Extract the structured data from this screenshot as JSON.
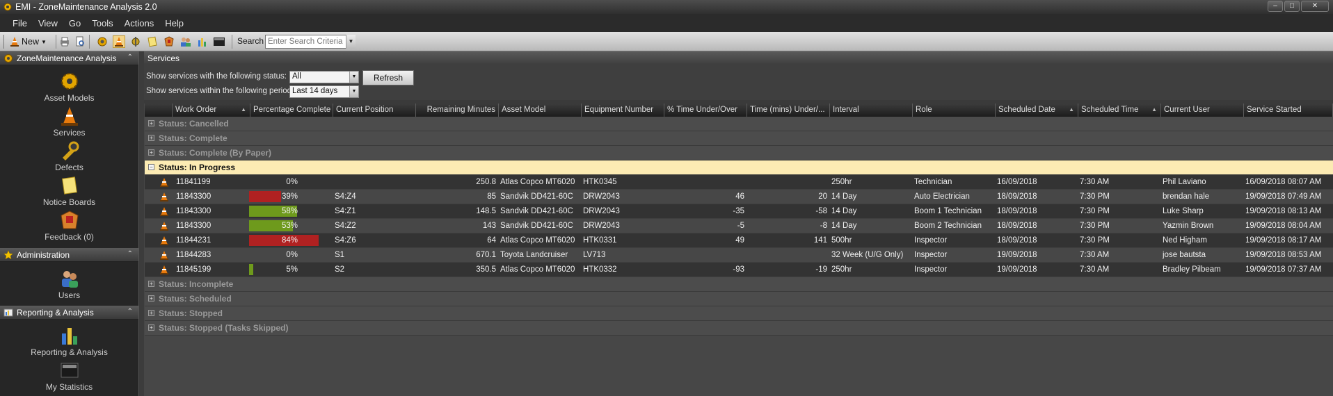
{
  "window": {
    "title": "EMI - ZoneMaintenance Analysis 2.0",
    "minimize": "–",
    "maximize": "□",
    "close": "✕"
  },
  "menu": [
    "File",
    "View",
    "Go",
    "Tools",
    "Actions",
    "Help"
  ],
  "toolbar": {
    "new_label": "New",
    "search_label": "Search",
    "search_placeholder": "Enter Search Criteria",
    "icons": [
      "print-icon",
      "preview-icon",
      "gear-icon",
      "cone-icon",
      "settings-icon",
      "note-icon",
      "feedback-icon",
      "users-icon",
      "chart-icon",
      "statistics-icon"
    ]
  },
  "sidebar": {
    "sections": [
      {
        "title": "ZoneMaintenance Analysis",
        "items": [
          "Asset Models",
          "Services",
          "Defects",
          "Notice Boards",
          "Feedback (0)"
        ]
      },
      {
        "title": "Administration",
        "items": [
          "Users"
        ]
      },
      {
        "title": "Reporting & Analysis",
        "items": [
          "Reporting & Analysis",
          "My Statistics"
        ]
      }
    ]
  },
  "services": {
    "header": "Services",
    "status_filter_label": "Show services with the following status:",
    "status_filter_value": "All",
    "period_filter_label": "Show services within the following period:",
    "period_filter_value": "Last 14 days",
    "refresh_label": "Refresh"
  },
  "grid": {
    "columns": [
      "Work Order",
      "Percentage Complete",
      "Current Position",
      "Remaining Minutes",
      "Asset Model",
      "Equipment Number",
      "% Time Under/Over",
      "Time (mins) Under/...",
      "Interval",
      "Role",
      "Scheduled Date",
      "Scheduled Time",
      "Current User",
      "Service Started"
    ],
    "groups_before": [
      "Status: Cancelled",
      "Status: Complete",
      "Status: Complete (By Paper)"
    ],
    "active_group": "Status: In Progress",
    "groups_after": [
      "Status: Incomplete",
      "Status: Scheduled",
      "Status: Stopped",
      "Status: Stopped (Tasks Skipped)"
    ],
    "rows": [
      {
        "work_order": "11841199",
        "pct": "0%",
        "pct_value": 0,
        "bar_color": "",
        "position": "",
        "remaining": "250.8",
        "asset": "Atlas Copco MT6020",
        "equipment": "HTK0345",
        "pct_time": "",
        "time_mins": "",
        "interval": "250hr",
        "role": "Technician",
        "sched_date": "16/09/2018",
        "sched_time": "7:30 AM",
        "user": "Phil Laviano",
        "started": "16/09/2018 08:07 AM"
      },
      {
        "work_order": "11843300",
        "pct": "39%",
        "pct_value": 39,
        "bar_color": "#b02121",
        "position": "S4:Z4",
        "remaining": "85",
        "asset": "Sandvik DD421-60C",
        "equipment": "DRW2043",
        "pct_time": "46",
        "time_mins": "20",
        "interval": "14 Day",
        "role": "Auto Electrician",
        "sched_date": "18/09/2018",
        "sched_time": "7:30 PM",
        "user": "brendan hale",
        "started": "19/09/2018 07:49 AM"
      },
      {
        "work_order": "11843300",
        "pct": "58%",
        "pct_value": 58,
        "bar_color": "#6e9a1c",
        "position": "S4:Z1",
        "remaining": "148.5",
        "asset": "Sandvik DD421-60C",
        "equipment": "DRW2043",
        "pct_time": "-35",
        "time_mins": "-58",
        "interval": "14 Day",
        "role": "Boom 1 Technician",
        "sched_date": "18/09/2018",
        "sched_time": "7:30 PM",
        "user": "Luke Sharp",
        "started": "19/09/2018 08:13 AM"
      },
      {
        "work_order": "11843300",
        "pct": "53%",
        "pct_value": 53,
        "bar_color": "#6e9a1c",
        "position": "S4:Z2",
        "remaining": "143",
        "asset": "Sandvik DD421-60C",
        "equipment": "DRW2043",
        "pct_time": "-5",
        "time_mins": "-8",
        "interval": "14 Day",
        "role": "Boom 2 Technician",
        "sched_date": "18/09/2018",
        "sched_time": "7:30 PM",
        "user": "Yazmin Brown",
        "started": "19/09/2018 08:04 AM"
      },
      {
        "work_order": "11844231",
        "pct": "84%",
        "pct_value": 84,
        "bar_color": "#b02121",
        "position": "S4:Z6",
        "remaining": "64",
        "asset": "Atlas Copco MT6020",
        "equipment": "HTK0331",
        "pct_time": "49",
        "time_mins": "141",
        "interval": "500hr",
        "role": "Inspector",
        "sched_date": "18/09/2018",
        "sched_time": "7:30 PM",
        "user": "Ned Higham",
        "started": "19/09/2018 08:17 AM"
      },
      {
        "work_order": "11844283",
        "pct": "0%",
        "pct_value": 0,
        "bar_color": "",
        "position": "S1",
        "remaining": "670.1",
        "asset": "Toyota Landcruiser",
        "equipment": "LV713",
        "pct_time": "",
        "time_mins": "",
        "interval": "32 Week (U/G Only)",
        "role": "Inspector",
        "sched_date": "19/09/2018",
        "sched_time": "7:30 AM",
        "user": "jose bautsta",
        "started": "19/09/2018 08:53 AM"
      },
      {
        "work_order": "11845199",
        "pct": "5%",
        "pct_value": 5,
        "bar_color": "#6e9a1c",
        "position": "S2",
        "remaining": "350.5",
        "asset": "Atlas Copco MT6020",
        "equipment": "HTK0332",
        "pct_time": "-93",
        "time_mins": "-19",
        "interval": "250hr",
        "role": "Inspector",
        "sched_date": "19/09/2018",
        "sched_time": "7:30 AM",
        "user": "Bradley Pilbeam",
        "started": "19/09/2018 07:37 AM"
      }
    ]
  }
}
